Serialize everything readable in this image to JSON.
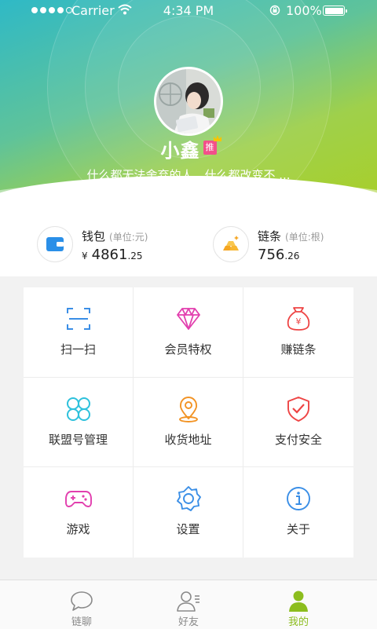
{
  "status_bar": {
    "carrier": "Carrier",
    "time": "4:34 PM",
    "battery": "100%"
  },
  "profile": {
    "name": "小鑫",
    "badge": "推",
    "signature": "什么都无法舍弃的人，什么都改变不 ..."
  },
  "wallet": {
    "label": "钱包",
    "unit": "(单位:元)",
    "currency": "¥",
    "value_int": "4861",
    "value_dec": ".25"
  },
  "chain": {
    "label": "链条",
    "unit": "(单位:根)",
    "value_int": "756",
    "value_dec": ".26"
  },
  "menu": [
    {
      "label": "扫一扫",
      "icon": "scan-icon",
      "color": "#3a8ee6"
    },
    {
      "label": "会员特权",
      "icon": "diamond-icon",
      "color": "#e23fae"
    },
    {
      "label": "赚链条",
      "icon": "money-bag-icon",
      "color": "#ee4444"
    },
    {
      "label": "联盟号管理",
      "icon": "link-icon",
      "color": "#2ec1dc"
    },
    {
      "label": "收货地址",
      "icon": "location-icon",
      "color": "#f29324"
    },
    {
      "label": "支付安全",
      "icon": "shield-icon",
      "color": "#ee4444"
    },
    {
      "label": "游戏",
      "icon": "gamepad-icon",
      "color": "#e23fae"
    },
    {
      "label": "设置",
      "icon": "gear-icon",
      "color": "#3a8ee6"
    },
    {
      "label": "关于",
      "icon": "info-icon",
      "color": "#3a8ee6"
    }
  ],
  "tabs": [
    {
      "label": "链聊",
      "icon": "chat-icon",
      "active": false
    },
    {
      "label": "好友",
      "icon": "friends-icon",
      "active": false
    },
    {
      "label": "我的",
      "icon": "profile-icon",
      "active": true
    }
  ],
  "colors": {
    "accent": "#8cbd1e",
    "tab_inactive": "#8a8a8a",
    "badge": "#f2508a"
  }
}
